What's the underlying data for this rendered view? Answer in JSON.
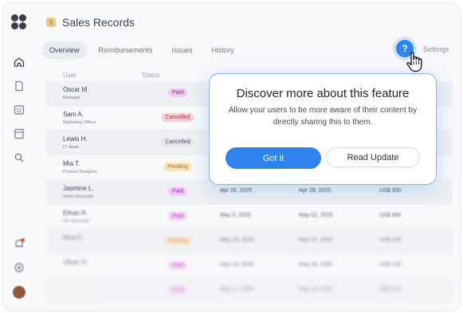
{
  "app": {
    "title": "Sales Records",
    "settings_label": "Settings",
    "help_label": "?"
  },
  "tabs": [
    {
      "label": "Overview",
      "active": true
    },
    {
      "label": "Reimbursements",
      "active": false
    },
    {
      "label": "Issues",
      "active": false
    },
    {
      "label": "History",
      "active": false
    }
  ],
  "sidebar": {
    "items": [
      "home-icon",
      "document-icon",
      "card-icon",
      "archive-icon",
      "search-icon",
      "notifications-icon",
      "settings-icon",
      "avatar"
    ]
  },
  "table": {
    "headers": {
      "user": "User",
      "status": "Status"
    },
    "rows": [
      {
        "name": "Oscar M.",
        "role": "Manager",
        "status": "Paid",
        "status_type": "paid",
        "date1": "",
        "date2": "",
        "amount": ""
      },
      {
        "name": "Sam A.",
        "role": "Marketing Officer",
        "status": "Cancelled",
        "status_type": "cancelled-red",
        "date1": "",
        "date2": "",
        "amount": ""
      },
      {
        "name": "Lewis H.",
        "role": "IT Head",
        "status": "Cancelled",
        "status_type": "cancelled-gray",
        "date1": "",
        "date2": "",
        "amount": ""
      },
      {
        "name": "Mia T.",
        "role": "Product Designer",
        "status": "Pending",
        "status_type": "pending",
        "date1": "",
        "date2": "",
        "amount": ""
      },
      {
        "name": "Jasmine L.",
        "role": "Sales Associate",
        "status": "Paid",
        "status_type": "paid",
        "date1": "Apr 26, 2025",
        "date2": "Apr 28, 2025",
        "amount": "US$ 300"
      },
      {
        "name": "Ethan R.",
        "role": "HR Specialist",
        "status": "Paid",
        "status_type": "paid",
        "date1": "May 3, 2025",
        "date2": "May 02, 2025",
        "amount": "US$ 460"
      },
      {
        "name": "Nina C.",
        "role": "",
        "status": "Pending",
        "status_type": "pending",
        "date1": "May 15, 2025",
        "date2": "May 15, 2025",
        "amount": "US$ 240"
      },
      {
        "name": "Oliver H.",
        "role": "",
        "status": "Paid",
        "status_type": "paid",
        "date1": "May 16, 2025",
        "date2": "May 16, 2025",
        "amount": "US$ 150"
      },
      {
        "name": "",
        "role": "",
        "status": "Paid",
        "status_type": "paid",
        "date1": "May 17, 2025",
        "date2": "May 19, 2025",
        "amount": "US$ 225"
      }
    ]
  },
  "popup": {
    "title": "Discover more about this feature",
    "description": "Allow your users to be more aware of their content by directly sharing this to them.",
    "primary_label": "Got it",
    "secondary_label": "Read Update"
  },
  "colors": {
    "accent": "#2e83ef",
    "paid": "#f3c8f3",
    "cancelled": "#f8cfd5",
    "pending": "#fbe2b9"
  }
}
